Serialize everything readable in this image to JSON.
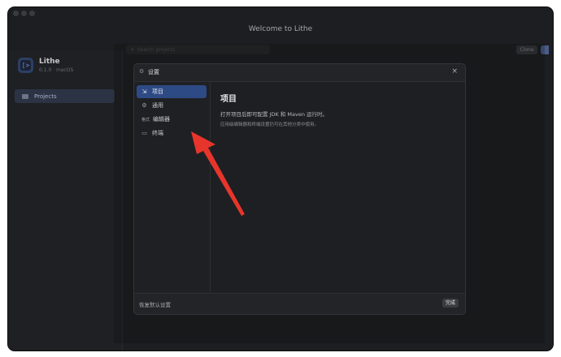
{
  "window": {
    "title": "Welcome to Lithe"
  },
  "app": {
    "name": "Lithe",
    "version": "0.1.0 · macOS",
    "icon": "code-bracket-icon"
  },
  "sidebar": {
    "items": [
      {
        "label": "Projects",
        "icon": "folder-icon",
        "selected": true
      }
    ]
  },
  "toolbar": {
    "search_placeholder": "Search projects",
    "clone_label": "Clone"
  },
  "dialog": {
    "title": "设置",
    "close_label": "×",
    "menu": [
      {
        "label": "项目",
        "icon": "folder-arrow-icon",
        "icon_glyph": "⇲",
        "active": true
      },
      {
        "label": "通用",
        "icon": "gear-icon",
        "icon_glyph": "⚙",
        "active": false
      },
      {
        "label": "编辑器",
        "icon": "format-icon",
        "icon_glyph": "格式",
        "active": false
      },
      {
        "label": "终端",
        "icon": "terminal-icon",
        "icon_glyph": "▭",
        "active": false
      }
    ],
    "main": {
      "title": "项目",
      "description": "打开项目后即可配置 JDK 和 Maven 运行时。",
      "subtext": "应用级编辑器和终端设置仍可在其他分类中使用。"
    },
    "footer": {
      "reset_label": "恢复默认设置",
      "done_label": "完成"
    }
  },
  "annotation": {
    "color": "#e8352b"
  },
  "colors": {
    "accent": "#2e4a85",
    "background": "#1d1e21"
  }
}
